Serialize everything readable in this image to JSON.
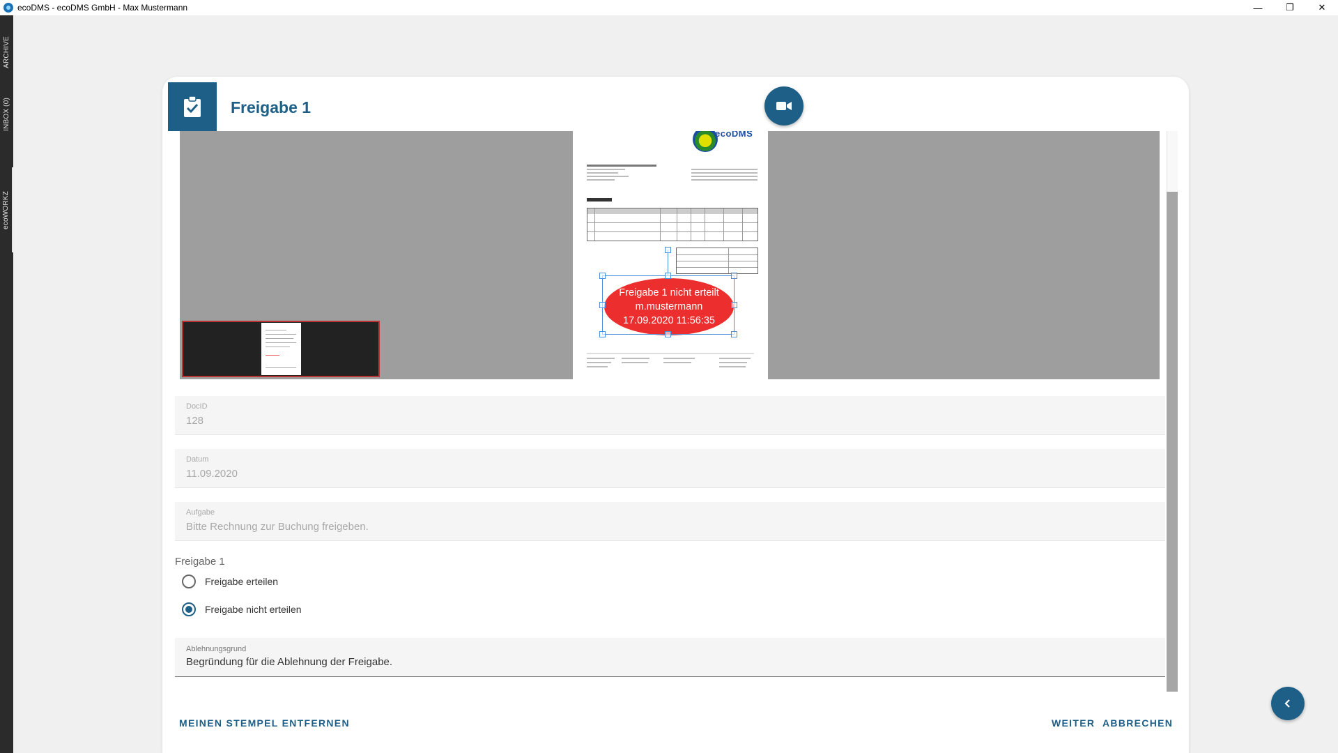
{
  "window": {
    "title": "ecoDMS - ecoDMS GmbH - Max Mustermann",
    "minimize": "—",
    "maximize": "❐",
    "close": "✕"
  },
  "rail": {
    "archive": "ARCHIVE",
    "inbox": "INBOX (0)",
    "ecoworkz": "ecoWORKZ"
  },
  "dialog": {
    "title": "Freigabe 1",
    "header_icon": "clipboard-check-icon",
    "camera_icon": "video-camera-icon"
  },
  "viewer": {
    "logo_text": "ecoDMS",
    "stamp": {
      "line1": "Freigabe 1 nicht erteilt",
      "line2": "m.mustermann",
      "line3": "17.09.2020 11:56:35"
    }
  },
  "fields": {
    "docid": {
      "label": "DocID",
      "value": "128"
    },
    "datum": {
      "label": "Datum",
      "value": "11.09.2020"
    },
    "aufgabe": {
      "label": "Aufgabe",
      "value": "Bitte Rechnung zur Buchung freigeben."
    },
    "ablehnungsgrund": {
      "label": "Ablehnungsgrund",
      "value": "Begründung für die Ablehnung der Freigabe."
    }
  },
  "approval": {
    "label": "Freigabe 1",
    "options": [
      {
        "label": "Freigabe erteilen",
        "checked": false
      },
      {
        "label": "Freigabe nicht erteilen",
        "checked": true
      }
    ]
  },
  "actions": {
    "remove_stamp": "MEINEN STEMPEL ENTFERNEN",
    "next": "WEITER",
    "cancel": "ABBRECHEN"
  },
  "colors": {
    "primary": "#1d5f87",
    "stamp_red": "#ed2e2e",
    "viewer_gray": "#9e9e9e"
  }
}
